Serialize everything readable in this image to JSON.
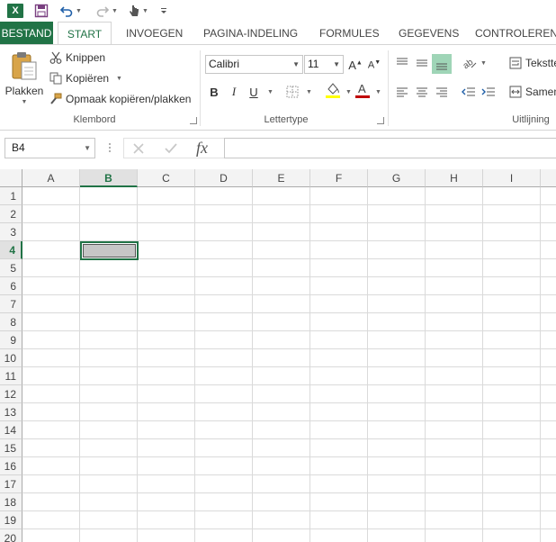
{
  "qat": {
    "excel_logo": "X",
    "icons": [
      "excel-logo",
      "save-icon",
      "undo-icon",
      "redo-icon",
      "touch-mode-icon",
      "customize-icon"
    ]
  },
  "tabs": {
    "file": "BESTAND",
    "start": "START",
    "insert": "INVOEGEN",
    "page_layout": "PAGINA-INDELING",
    "formulas": "FORMULES",
    "data": "GEGEVENS",
    "review": "CONTROLEREN"
  },
  "clipboard": {
    "paste": "Plakken",
    "cut": "Knippen",
    "copy": "Kopiëren",
    "format_painter": "Opmaak kopiëren/plakken",
    "group_label": "Klembord"
  },
  "font": {
    "name": "Calibri",
    "size": "11",
    "bold": "B",
    "italic": "I",
    "underline": "U",
    "group_label": "Lettertype"
  },
  "alignment": {
    "wrap_text": "Tekstte",
    "merge": "Samen",
    "group_label": "Uitlijning"
  },
  "formula_bar": {
    "name_box": "B4",
    "fx": "fx",
    "formula": ""
  },
  "grid": {
    "columns": [
      "A",
      "B",
      "C",
      "D",
      "E",
      "F",
      "G",
      "H",
      "I"
    ],
    "rows": [
      "1",
      "2",
      "3",
      "4",
      "5",
      "6",
      "7",
      "8",
      "9",
      "10",
      "11",
      "12",
      "13",
      "14",
      "15",
      "16",
      "17",
      "18",
      "19",
      "20"
    ],
    "selected_column": "B",
    "selected_row": "4"
  },
  "colors": {
    "accent": "#217346",
    "font_highlight": "#ffff00",
    "font_color": "#c00000"
  }
}
